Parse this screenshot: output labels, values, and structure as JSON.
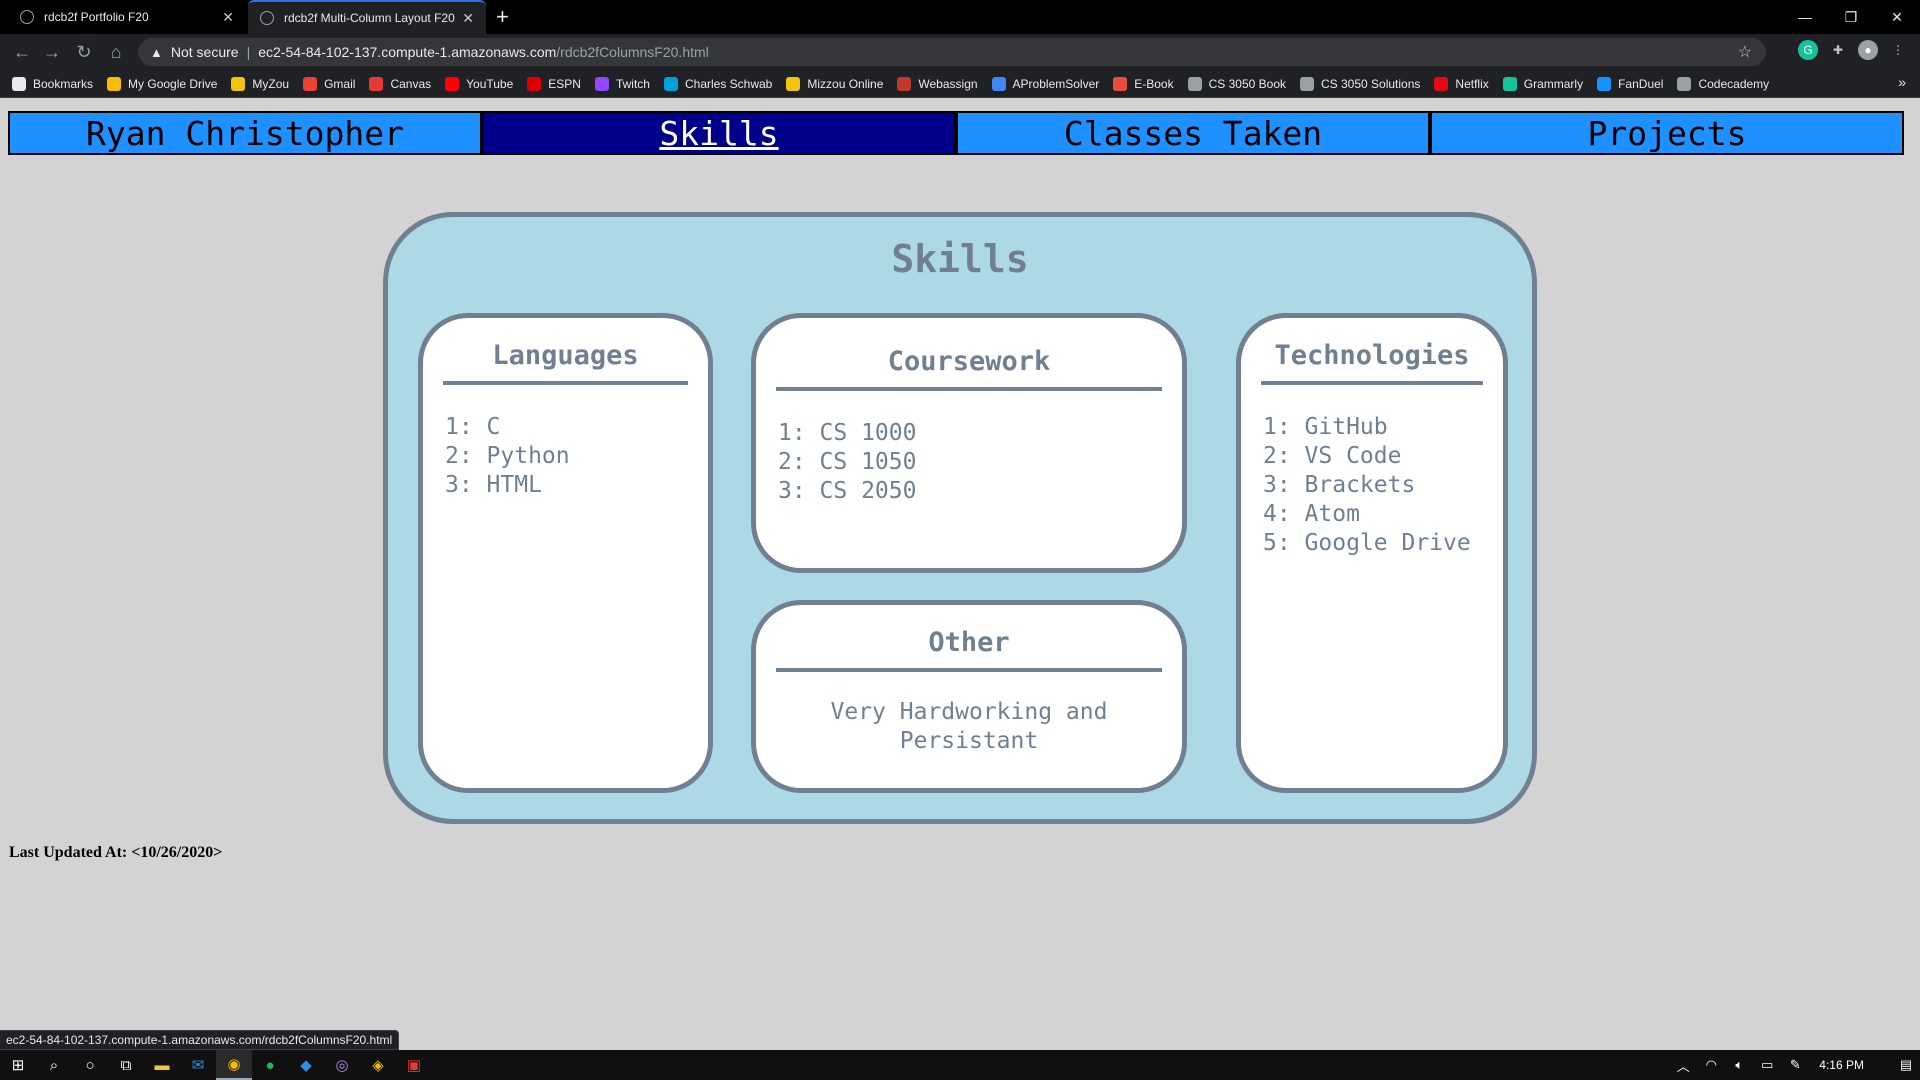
{
  "browser": {
    "tabs": [
      {
        "title": "rdcb2f Portfolio F20",
        "active": false
      },
      {
        "title": "rdcb2f Multi-Column Layout F20",
        "active": true
      }
    ],
    "security_label": "Not secure",
    "url_host": "ec2-54-84-102-137.compute-1.amazonaws.com",
    "url_path": "/rdcb2fColumnsF20.html",
    "bookmarks": [
      {
        "label": "Bookmarks",
        "icon": "star-icon",
        "color": "#e8eaed"
      },
      {
        "label": "My Google Drive",
        "icon": "drive-icon",
        "color": "#fbbc04"
      },
      {
        "label": "MyZou",
        "icon": "myzou-icon",
        "color": "#f1c40f"
      },
      {
        "label": "Gmail",
        "icon": "gmail-icon",
        "color": "#ea4335"
      },
      {
        "label": "Canvas",
        "icon": "canvas-icon",
        "color": "#e53935"
      },
      {
        "label": "YouTube",
        "icon": "youtube-icon",
        "color": "#ff0000"
      },
      {
        "label": "ESPN",
        "icon": "espn-icon",
        "color": "#d00"
      },
      {
        "label": "Twitch",
        "icon": "twitch-icon",
        "color": "#9146ff"
      },
      {
        "label": "Charles Schwab",
        "icon": "schwab-icon",
        "color": "#00a0df"
      },
      {
        "label": "Mizzou Online",
        "icon": "mizzou-icon",
        "color": "#f1c40f"
      },
      {
        "label": "Webassign",
        "icon": "webassign-icon",
        "color": "#c0392b"
      },
      {
        "label": "AProblemSolver",
        "icon": "aproblemsolver-icon",
        "color": "#4285f4"
      },
      {
        "label": "E-Book",
        "icon": "ebook-icon",
        "color": "#e74c3c"
      },
      {
        "label": "CS 3050 Book",
        "icon": "globe-icon",
        "color": "#9aa0a6"
      },
      {
        "label": "CS 3050 Solutions",
        "icon": "solutions-icon",
        "color": "#9aa0a6"
      },
      {
        "label": "Netflix",
        "icon": "netflix-icon",
        "color": "#e50914"
      },
      {
        "label": "Grammarly",
        "icon": "grammarly-icon",
        "color": "#15c39a"
      },
      {
        "label": "FanDuel",
        "icon": "fanduel-icon",
        "color": "#1493ff"
      },
      {
        "label": "Codecademy",
        "icon": "codecademy-icon",
        "color": "#9aa0a6"
      }
    ]
  },
  "site": {
    "nav": [
      "Ryan Christopher",
      "Skills",
      "Classes Taken",
      "Projects"
    ],
    "active_nav": "Skills",
    "panel_title": "Skills",
    "cards": {
      "languages": {
        "title": "Languages",
        "items": [
          "1: C",
          "2: Python",
          "3: HTML"
        ]
      },
      "coursework": {
        "title": "Coursework",
        "items": [
          "1: CS 1000",
          "2: CS 1050",
          "3: CS 2050"
        ]
      },
      "other": {
        "title": "Other",
        "text": "Very Hardworking and Persistant"
      },
      "technologies": {
        "title": "Technologies",
        "items": [
          "1: GitHub",
          "2: VS Code",
          "3: Brackets",
          "4: Atom",
          "5: Google Drive"
        ]
      }
    },
    "last_updated": "Last Updated At: <10/26/2020>"
  },
  "status_bar_url": "ec2-54-84-102-137.compute-1.amazonaws.com/rdcb2fColumnsF20.html",
  "taskbar": {
    "apps": [
      "windows-start-icon",
      "search-icon",
      "cortana-icon",
      "task-view-icon",
      "file-explorer-icon",
      "mail-icon",
      "chrome-icon",
      "spotify-icon",
      "vscode-icon",
      "app-icon",
      "git-icon",
      "filezilla-icon"
    ],
    "clock": "4:16 PM"
  },
  "colors": {
    "nav_bg": "#1e90ff",
    "nav_active_bg": "#00008b",
    "panel_bg": "#add8e6",
    "border": "#708090",
    "page_bg": "#d3d3d3"
  }
}
